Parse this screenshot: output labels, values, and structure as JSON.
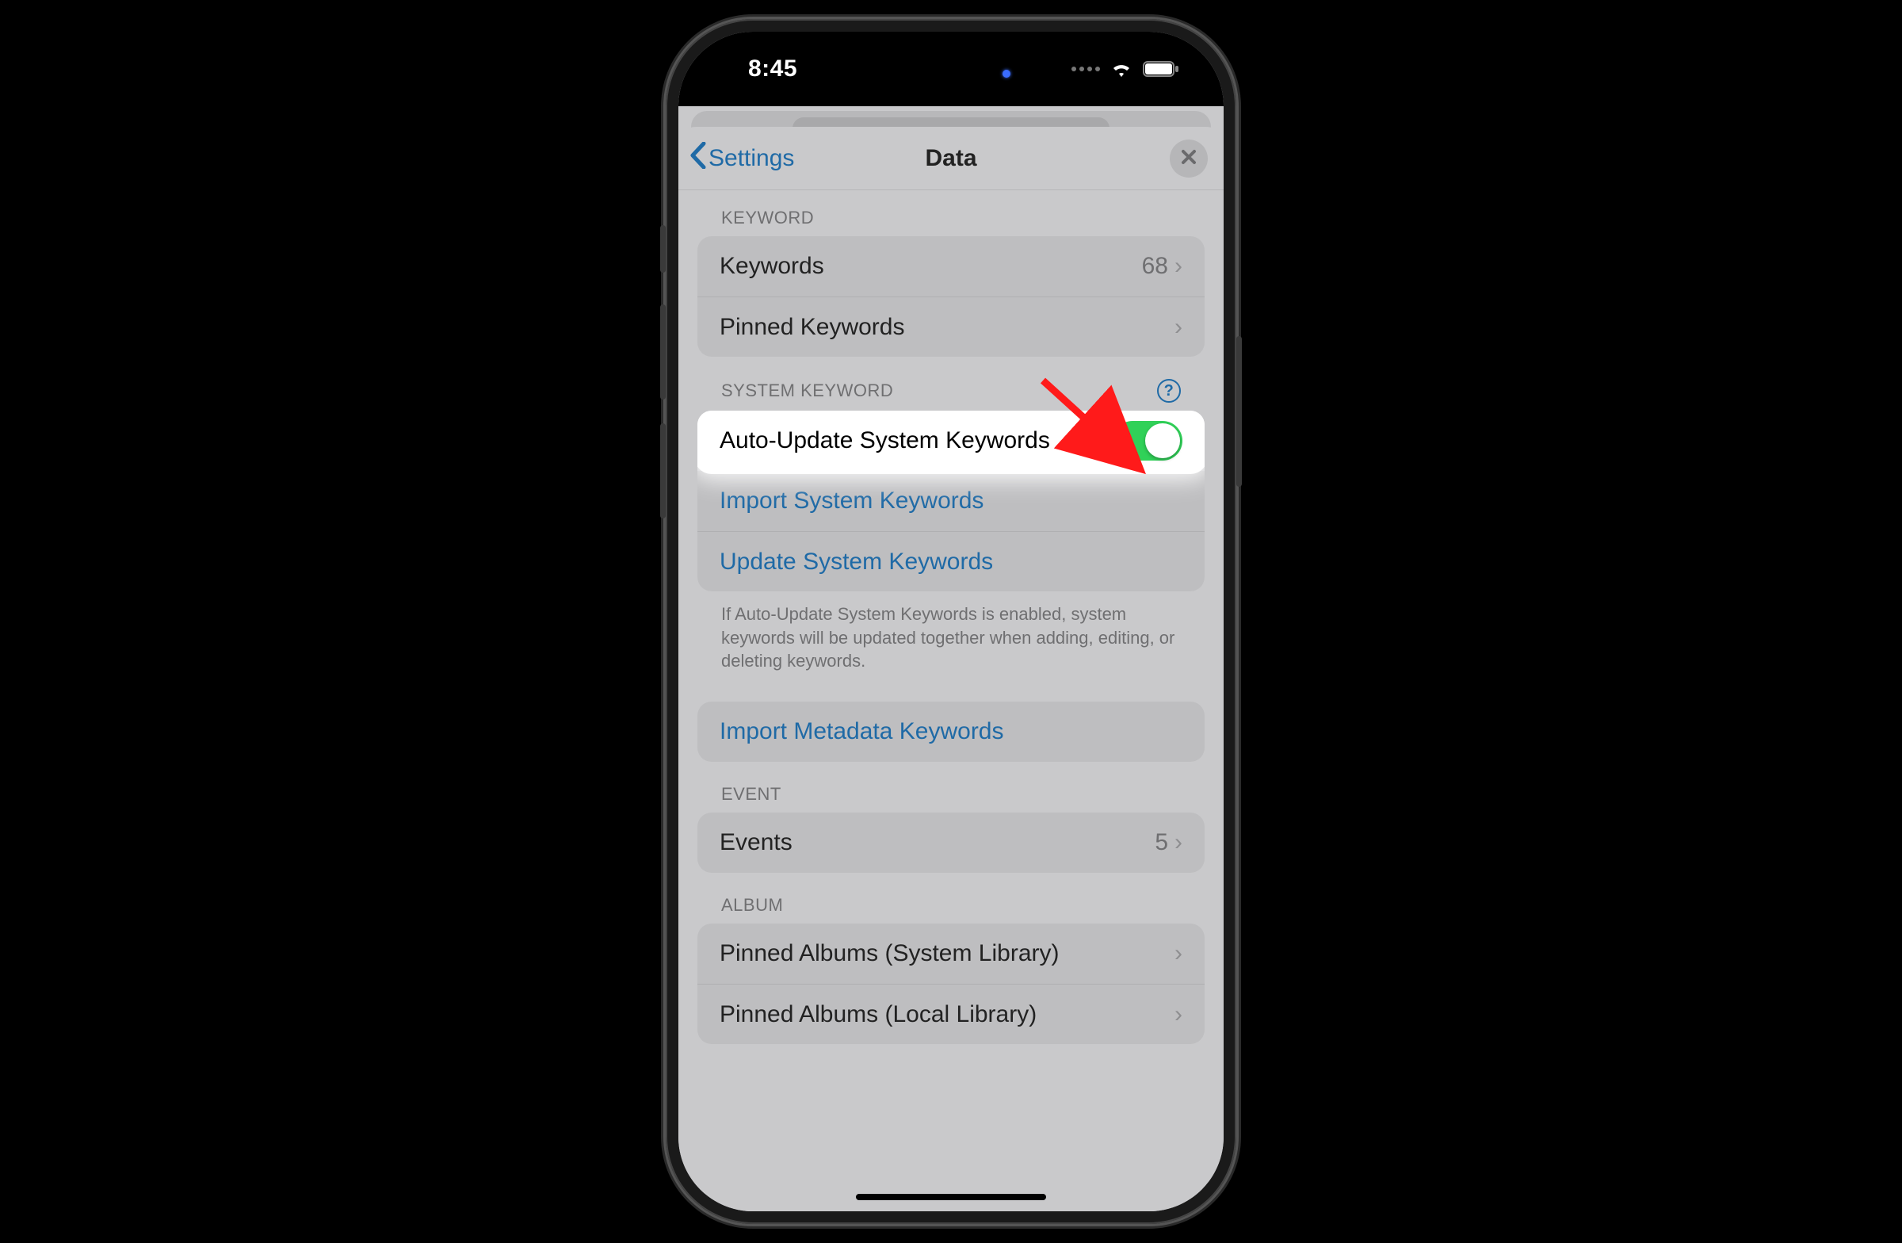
{
  "statusbar": {
    "time": "8:45"
  },
  "navbar": {
    "back_label": "Settings",
    "title": "Data"
  },
  "sections": {
    "keyword": {
      "header": "KEYWORD",
      "keywords_label": "Keywords",
      "keywords_count": "68",
      "pinned_label": "Pinned Keywords"
    },
    "system_keyword": {
      "header": "SYSTEM KEYWORD",
      "auto_update_label": "Auto-Update System Keywords",
      "auto_update_on": true,
      "import_label": "Import System Keywords",
      "update_label": "Update System Keywords",
      "footer": "If Auto-Update System Keywords is enabled, system keywords will be updated together when adding, editing, or deleting keywords."
    },
    "metadata": {
      "import_label": "Import Metadata Keywords"
    },
    "event": {
      "header": "EVENT",
      "events_label": "Events",
      "events_count": "5"
    },
    "album": {
      "header": "ALBUM",
      "system_label": "Pinned Albums (System Library)",
      "local_label": "Pinned Albums (Local Library)"
    }
  }
}
